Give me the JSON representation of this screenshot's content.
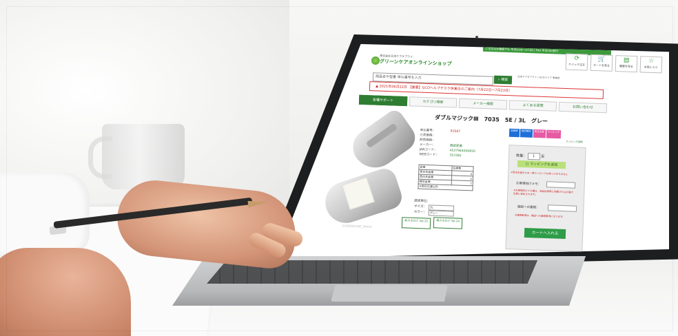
{
  "site": {
    "topbar": "ご注文はお電話でも 平日9:00〜17:00 / FAX 平日24h受付",
    "logo_line1": "株式会社日本ケアサプライ",
    "logo_line2": "グリーンケアオンラインショップ",
    "header_icons": [
      {
        "icon": "clock-icon",
        "label": "クイック注文"
      },
      {
        "icon": "cart-icon",
        "label": "カートを見る"
      },
      {
        "icon": "history-icon",
        "label": "履歴を見る"
      },
      {
        "icon": "star-icon",
        "label": "お気に入り"
      }
    ],
    "search_placeholder": "商品名や型番 申込番号を入力",
    "search_button": "検索",
    "mini_links": "日本ケアサプライ / GCOストア 事業部",
    "notice": "2021年06月22日 【重要】GCOヘルプデスク休業日のご案内（7月22日〜7月23日）",
    "nav_tabs": [
      "各種サポート",
      "カテゴリ検索",
      "メーカー検索",
      "よくある質問",
      "お問い合わせ"
    ]
  },
  "product": {
    "title": "ダブルマジックⅢ　7035　5E / 3L　グレー",
    "specs": [
      {
        "k": "申込番号：",
        "v": "R3567"
      },
      {
        "k": "小売価格：",
        "v": ""
      },
      {
        "k": "卸売価格：",
        "v": ""
      },
      {
        "k": "メーカー：",
        "v": "徳武産業"
      },
      {
        "k": "JANコード：",
        "v": "4537944000650"
      },
      {
        "k": "WEBコード：",
        "v": "353382"
      }
    ],
    "stock_headers": [
      "倉庫",
      "在庫数"
    ],
    "stock_rows": [
      [
        "東日本倉庫",
        "0"
      ],
      [
        "西日本倉庫",
        "0"
      ],
      [
        "横浜倉庫",
        "7"
      ]
    ],
    "stock_note": "※弊社在庫以外",
    "option_labels": [
      "請求単位：",
      "サイズ：",
      "カラー："
    ],
    "option_values": [
      "",
      "3L",
      "グレー"
    ],
    "catalogs": [
      "前カタログ Vol.35",
      "現カタログ Vol.29"
    ],
    "tags": [
      "非課税",
      "送料無料",
      "受注生産",
      "ラッピング"
    ],
    "tag_colors": [
      "#1e6fd9",
      "#1e6fd9",
      "#e65aa3",
      "#e65aa3"
    ],
    "corner_link": "ラッピング説明",
    "qty_label": "数量：",
    "qty_value": "1",
    "qty_unit": "足",
    "wrap_button": "ラッピングを追加",
    "wrap_note": "※受注生産のため一律ラッピングは承っておりません",
    "memo_label": "お客様向けメモ：",
    "memo_note": "※お客様向けメモ欄は、商品出荷時に同梱されるお届け伝票に表示されます。",
    "shipping_label": "施設への連絡：",
    "shipping_note": "※連絡事項は、施設への連絡事項になります。",
    "cart_button": "カートへ入れる",
    "watermark": "©GREENCARE_IMAGE"
  }
}
